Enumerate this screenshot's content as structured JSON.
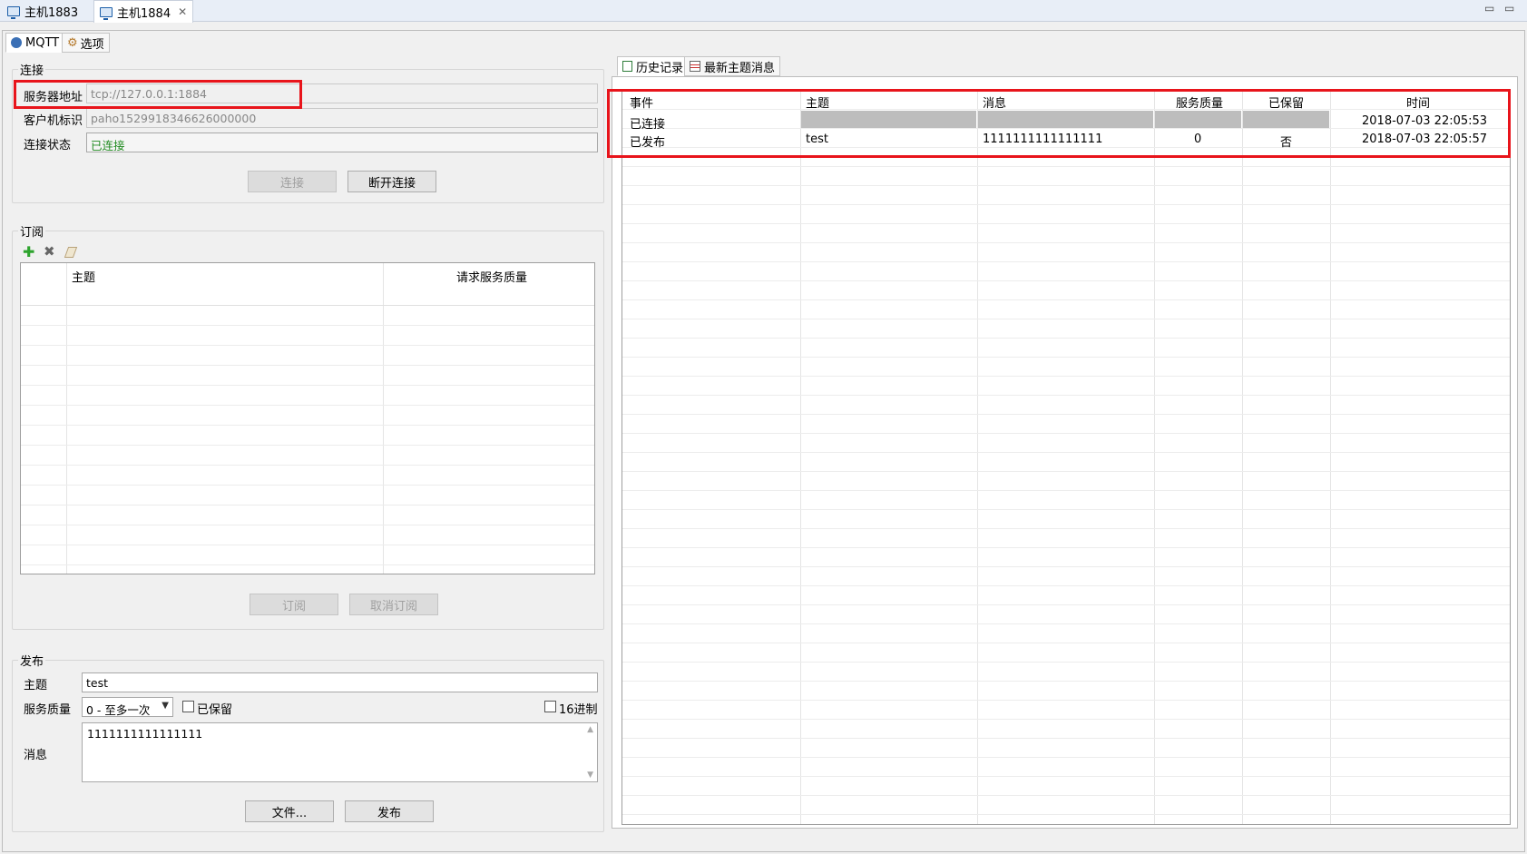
{
  "window_tabs": [
    {
      "label": "主机1883",
      "active": false
    },
    {
      "label": "主机1884",
      "active": true
    }
  ],
  "window_controls": {
    "minimize": "▭",
    "maximize": "▭"
  },
  "left_tabs": [
    {
      "label": "MQTT",
      "icon": "mqtt-icon",
      "active": true
    },
    {
      "label": "选项",
      "icon": "gear-icon",
      "active": false
    }
  ],
  "connection": {
    "group_title": "连接",
    "server_label": "服务器地址",
    "server_value": "tcp://127.0.0.1:1884",
    "client_label": "客户机标识",
    "client_value": "paho1529918346626000000",
    "status_label": "连接状态",
    "status_value": "已连接",
    "connect_button": "连接",
    "disconnect_button": "断开连接"
  },
  "subscription": {
    "group_title": "订阅",
    "columns": [
      "",
      "主题",
      "请求服务质量"
    ],
    "subscribe_button": "订阅",
    "unsubscribe_button": "取消订阅"
  },
  "publish": {
    "group_title": "发布",
    "topic_label": "主题",
    "topic_value": "test",
    "qos_label": "服务质量",
    "qos_value": "0 - 至多一次",
    "retained_label": "已保留",
    "hex_label": "16进制",
    "message_label": "消息",
    "message_value": "1111111111111111",
    "file_button": "文件...",
    "publish_button": "发布"
  },
  "right_tabs": [
    {
      "label": "历史记录",
      "icon": "history-icon",
      "active": true
    },
    {
      "label": "最新主题消息",
      "icon": "list-icon",
      "active": false
    }
  ],
  "history": {
    "columns": [
      "事件",
      "主题",
      "消息",
      "服务质量",
      "已保留",
      "时间"
    ],
    "rows": [
      {
        "event": "已连接",
        "topic": "",
        "message": "",
        "qos": "",
        "retained": "",
        "time": "2018-07-03 22:05:53"
      },
      {
        "event": "已发布",
        "topic": "test",
        "message": "1111111111111111",
        "qos": "0",
        "retained": "否",
        "time": "2018-07-03 22:05:57"
      }
    ]
  },
  "colors": {
    "highlight": "#e8141b",
    "status_green": "#1f8a1f"
  }
}
